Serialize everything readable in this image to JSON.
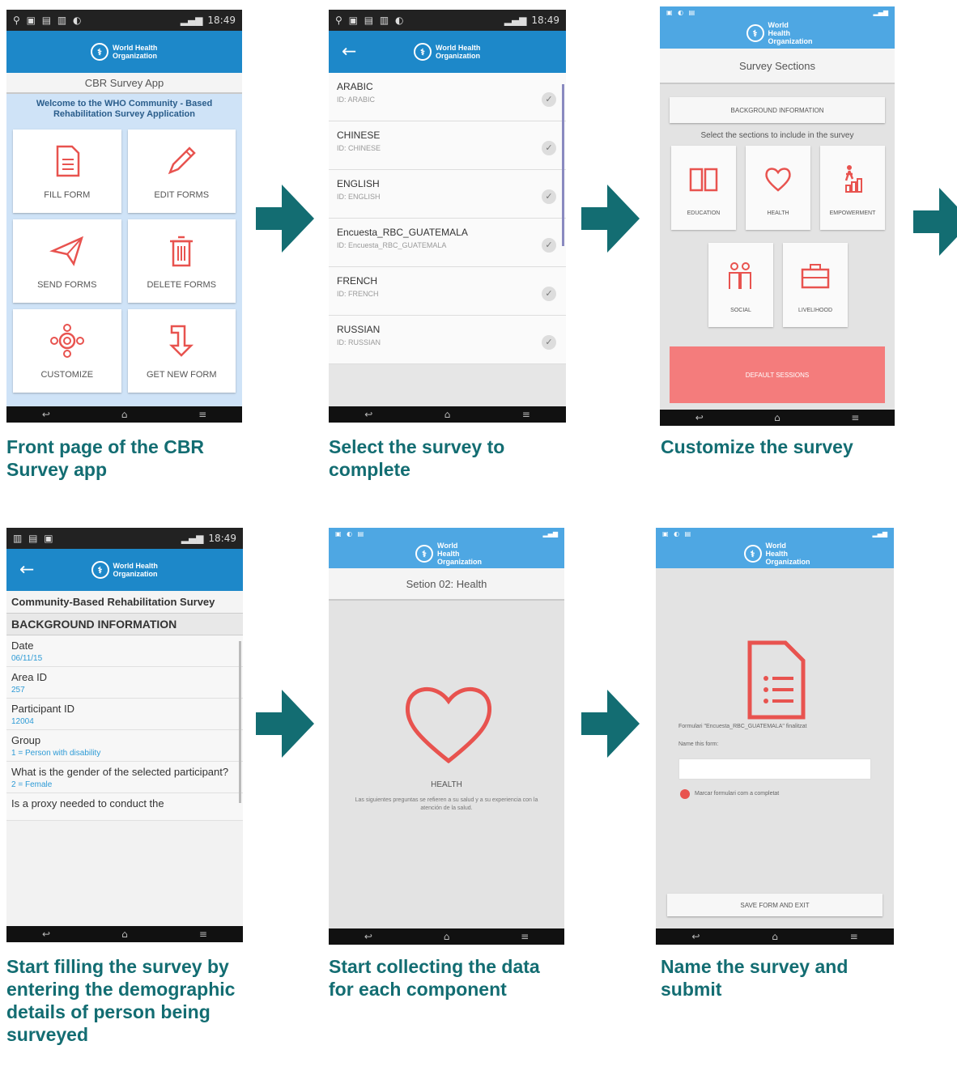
{
  "colors": {
    "caption": "#136d72",
    "app_bar": "#1d88c9",
    "app_bar_light": "#4ea7e3",
    "accent": "#e8534f"
  },
  "phone1": {
    "time": "18:49",
    "logo_text": "World Health Organization",
    "title": "CBR Survey App",
    "welcome": "Welcome to the WHO Community - Based Rehabilitation Survey Application",
    "tiles": [
      {
        "label": "FILL FORM",
        "icon": "document-icon"
      },
      {
        "label": "EDIT FORMS",
        "icon": "pencil-icon"
      },
      {
        "label": "SEND FORMS",
        "icon": "paper-plane-icon"
      },
      {
        "label": "DELETE FORMS",
        "icon": "trash-icon"
      },
      {
        "label": "CUSTOMIZE",
        "icon": "gears-icon"
      },
      {
        "label": "GET NEW FORM",
        "icon": "download-arrow-icon"
      }
    ]
  },
  "phone2": {
    "time": "18:49",
    "languages": [
      {
        "name": "ARABIC",
        "id": "ID: ARABIC"
      },
      {
        "name": "CHINESE",
        "id": "ID: CHINESE"
      },
      {
        "name": "ENGLISH",
        "id": "ID: ENGLISH"
      },
      {
        "name": "Encuesta_RBC_GUATEMALA",
        "id": "ID: Encuesta_RBC_GUATEMALA"
      },
      {
        "name": "FRENCH",
        "id": "ID: FRENCH"
      },
      {
        "name": "RUSSIAN",
        "id": "ID: RUSSIAN"
      }
    ]
  },
  "phone3": {
    "title": "Survey Sections",
    "background_button": "BACKGROUND INFORMATION",
    "select_text": "Select the sections to include in the survey",
    "sections": [
      "EDUCATION",
      "HEALTH",
      "EMPOWERMENT",
      "SOCIAL",
      "LIVELIHOOD"
    ],
    "default_button": "DEFAULT SESSIONS"
  },
  "phone4": {
    "time": "18:49",
    "survey_title": "Community-Based Rehabilitation Survey",
    "section": "BACKGROUND INFORMATION",
    "fields": [
      {
        "q": "Date",
        "a": "06/11/15"
      },
      {
        "q": "Area ID",
        "a": "257"
      },
      {
        "q": "Participant ID",
        "a": "12004"
      },
      {
        "q": "Group",
        "a": "1 = Person with disability"
      },
      {
        "q": "What is the gender of the selected participant?",
        "a": "2 = Female"
      },
      {
        "q": "Is a proxy needed to conduct the",
        "a": ""
      }
    ]
  },
  "phone5": {
    "title": "Setion 02: Health",
    "heading": "HEALTH",
    "description": "Las siguientes preguntas se refieren a su salud y a su experiencia con la atención de la salud."
  },
  "phone6": {
    "finalized": "Formulari \"Encuesta_RBC_GUATEMALA\" finalitzat",
    "name_label": "Name this form:",
    "mark_complete": "Marcar formulari com a completat",
    "save_button": "SAVE FORM AND EXIT"
  },
  "captions": {
    "c1": "Front page of the CBR Survey app",
    "c2": "Select the survey to complete",
    "c3": "Customize the survey",
    "c4": "Start filling the survey by entering the demographic details of person being surveyed",
    "c5": "Start collecting the data for each component",
    "c6": "Name the survey and submit"
  }
}
